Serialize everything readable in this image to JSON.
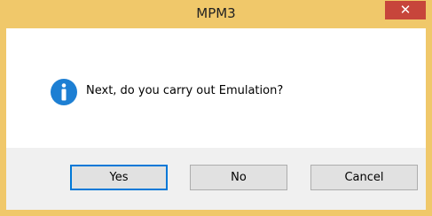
{
  "window": {
    "title": "MPM3",
    "close_symbol": "✕"
  },
  "dialog": {
    "icon": "info-icon",
    "message": "Next, do you carry out Emulation?"
  },
  "buttons": {
    "yes": "Yes",
    "no": "No",
    "cancel": "Cancel"
  },
  "colors": {
    "titlebar": "#f0c86a",
    "close": "#c7453b",
    "icon": "#1d7fd3",
    "default_button_border": "#0078d7"
  }
}
